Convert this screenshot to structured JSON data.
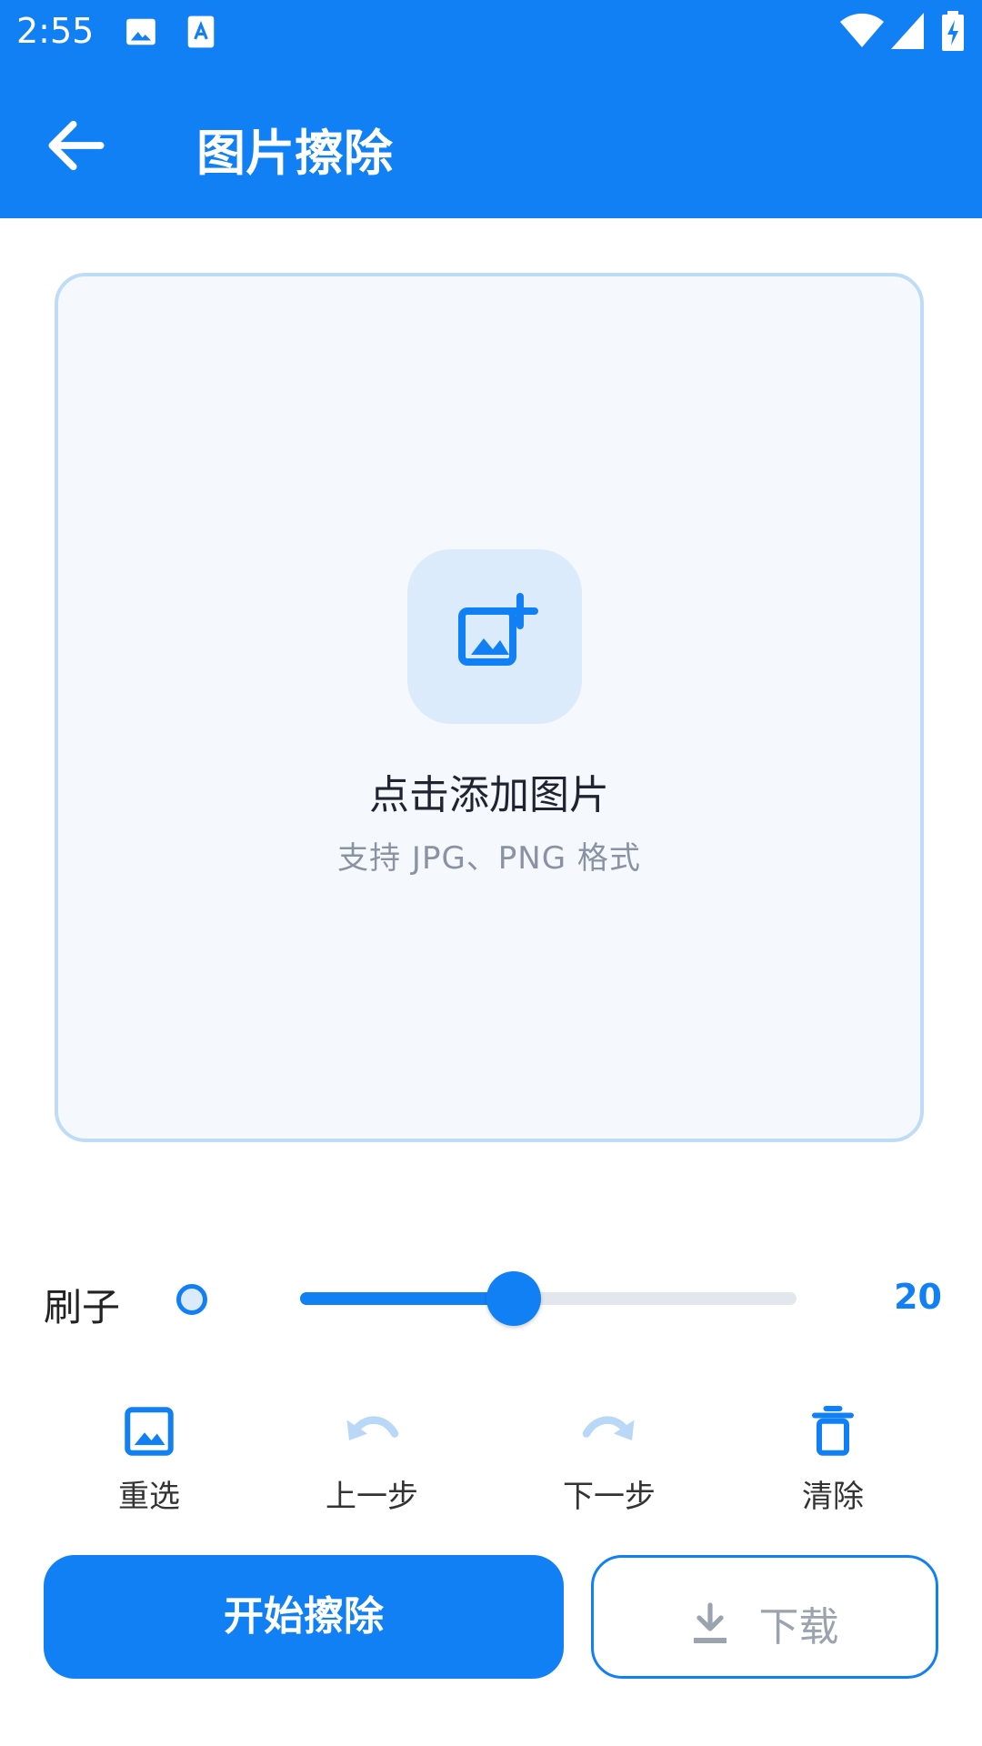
{
  "status": {
    "time": "2:55"
  },
  "header": {
    "title": "图片擦除"
  },
  "canvas": {
    "add_title": "点击添加图片",
    "add_subtitle": "支持 JPG、PNG 格式"
  },
  "brush": {
    "label": "刷子",
    "value": "20",
    "slider_fraction": 0.43
  },
  "tools": [
    {
      "label": "重选",
      "icon": "image-icon",
      "enabled": true
    },
    {
      "label": "上一步",
      "icon": "undo-icon",
      "enabled": false
    },
    {
      "label": "下一步",
      "icon": "redo-icon",
      "enabled": false
    },
    {
      "label": "清除",
      "icon": "trash-icon",
      "enabled": true
    }
  ],
  "actions": {
    "start_label": "开始擦除",
    "download_label": "下载"
  },
  "colors": {
    "primary": "#1280f5",
    "disabled_icon": "#b9d8f7",
    "disabled_text": "#9aa3ae"
  }
}
